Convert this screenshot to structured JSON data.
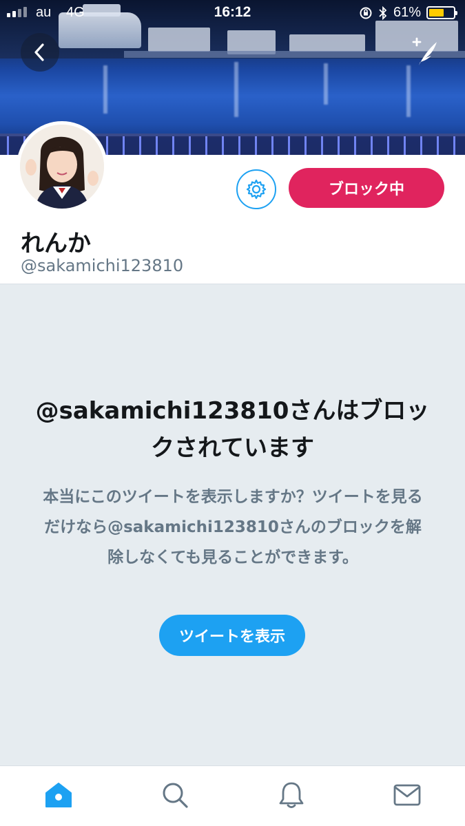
{
  "status_bar": {
    "carrier": "au",
    "network": "4G",
    "time": "16:12",
    "battery_percent": "61%",
    "battery_level": 0.61,
    "battery_color": "#ffcc00"
  },
  "header": {
    "back_icon": "chevron-left-icon",
    "compose_icon": "compose-tweet-icon"
  },
  "profile": {
    "display_name": "れんか",
    "handle": "@sakamichi123810",
    "settings_icon": "gear-icon",
    "block_button_label": "ブロック中",
    "block_button_color": "#e0245e"
  },
  "blocked_notice": {
    "title": "@sakamichi123810さんはブロックされています",
    "description": "本当にこのツイートを表示しますか？ツイートを見るだけなら@sakamichi123810さんのブロックを解除しなくても見ることができます。",
    "view_button_label": "ツイートを表示",
    "accent_color": "#1da1f2"
  },
  "tab_bar": {
    "tabs": [
      {
        "icon": "home-icon",
        "active": true
      },
      {
        "icon": "search-icon",
        "active": false
      },
      {
        "icon": "bell-icon",
        "active": false
      },
      {
        "icon": "mail-icon",
        "active": false
      }
    ]
  }
}
